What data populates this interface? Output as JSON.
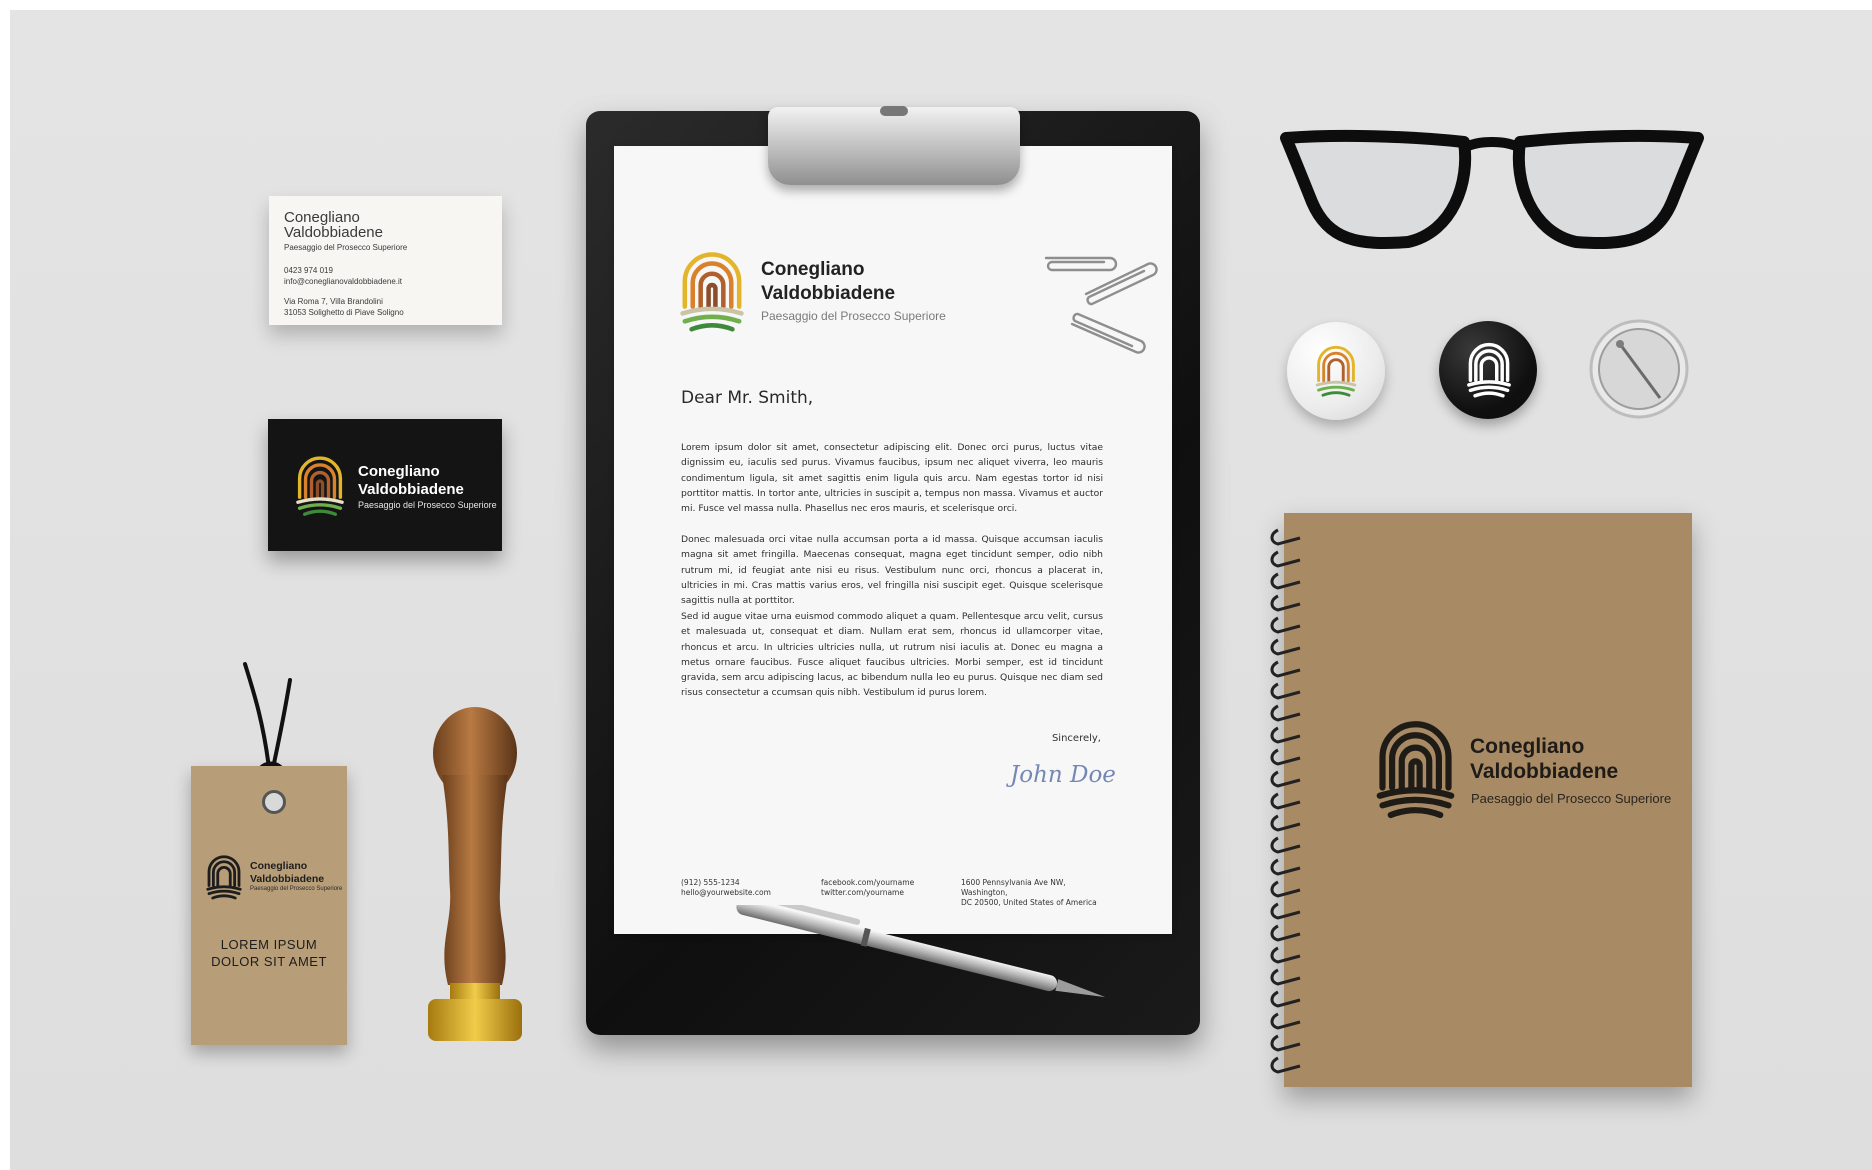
{
  "brand": {
    "name_line1": "Conegliano",
    "name_line2": "Valdobbiadene",
    "tagline": "Paesaggio del Prosecco Superiore"
  },
  "business_card_white": {
    "name_line1": "Conegliano",
    "name_line2": "Valdobbiadene",
    "tagline": "Paesaggio del Prosecco Superiore",
    "phone": "0423 974 019",
    "email": "info@coneglianovaldobbiadene.it",
    "address_line1": "Via Roma 7, Villa Brandolini",
    "address_line2": "31053 Solighetto di Piave Soligno"
  },
  "letter": {
    "greeting": "Dear Mr. Smith,",
    "paragraph1": "Lorem ipsum dolor sit amet, consectetur adipiscing elit. Donec orci purus, luctus vitae dignissim eu, iaculis sed purus. Vivamus faucibus, ipsum nec aliquet viverra, leo mauris condimentum ligula, sit amet sagittis enim ligula quis arcu. Nam egestas tortor id nisi porttitor mattis. In tortor ante, ultricies in suscipit a, tempus non massa. Vivamus et auctor mi. Fusce vel massa nulla. Phasellus nec eros mauris, et scelerisque orci.",
    "paragraph2": "Donec malesuada orci vitae nulla accumsan porta a id massa. Quisque accumsan iaculis magna sit amet fringilla. Maecenas consequat, magna eget tincidunt semper, odio nibh rutrum mi, id feugiat ante nisi eu risus. Vestibulum nunc orci, rhoncus a placerat in, ultricies in mi. Cras mattis varius eros, vel fringilla nisi suscipit eget. Quisque scelerisque sagittis nulla at porttitor.",
    "paragraph3": "Sed id augue vitae urna euismod commodo aliquet a quam. Pellentesque arcu velit, cursus et malesuada ut, consequat et diam. Nullam erat sem, rhoncus id ullamcorper vitae, rhoncus et arcu. In ultricies ultricies nulla, ut rutrum nisi iaculis at. Donec eu magna a metus ornare faucibus. Fusce aliquet faucibus ultricies. Morbi semper, est id tincidunt gravida, sem arcu adipiscing lacus, ac bibendum nulla leo eu purus. Quisque nec diam sed risus consectetur a ccumsan quis nibh. Vestibulum id purus lorem.",
    "closing": "Sincerely,",
    "signature": "John Doe",
    "footer": {
      "phone": "(912) 555-1234",
      "email": "hello@yourwebsite.com",
      "facebook": "facebook.com/yourname",
      "twitter": "twitter.com/yourname",
      "address_line1": "1600 Pennsylvania Ave NW, Washington,",
      "address_line2": "DC 20500, United States of America"
    }
  },
  "hang_tag": {
    "lorem_line1": "LOREM IPSUM",
    "lorem_line2": "DOLOR SIT AMET"
  },
  "colors": {
    "background": "#e2e2e2",
    "kraft": "#a88b65",
    "logo_yellow": "#e3b52b",
    "logo_orange": "#d9822b",
    "logo_brown": "#8a4e2a",
    "logo_green": "#3f8a3a"
  },
  "icons": [
    "fingerprint-logo-icon",
    "paperclip-icon",
    "glasses-icon",
    "pin-button-icon",
    "stamp-icon",
    "pen-icon"
  ]
}
